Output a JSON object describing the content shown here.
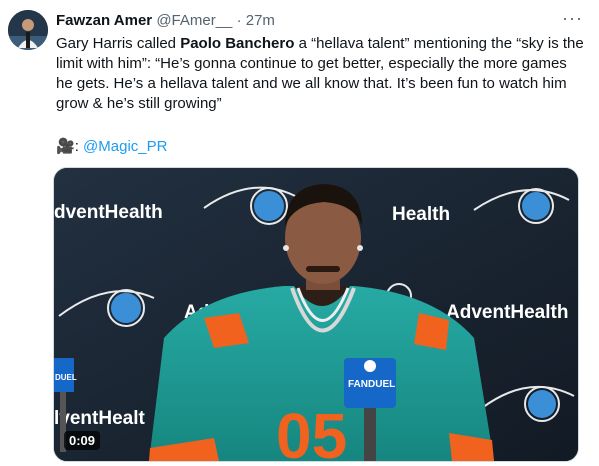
{
  "tweet": {
    "author_name": "Fawzan Amer",
    "handle": "@FAmer__",
    "separator": "·",
    "time": "27m",
    "more_label": "···",
    "text_before": "Gary Harris called ",
    "text_bold": "Paolo Banchero",
    "text_after": " a “hellava talent” mentioning the “sky is the limit with him”: “He’s gonna continue to get better, especially the more games he gets. He’s a hellava talent and we all know that. It’s been fun to watch him grow & he’s still growing”",
    "credit_icon": "🎥",
    "credit_colon": ": ",
    "credit_link": "@Magic_PR"
  },
  "media": {
    "duration": "0:09",
    "backdrop_text": [
      "dventHealth",
      "Health",
      "Adv",
      "AdventHealth",
      "lventHealt"
    ],
    "mic_brand": "FANDUEL",
    "mic_left_text": "DUEL",
    "jersey_number": "05"
  },
  "icons": {
    "avatar": "avatar",
    "more": "more-icon",
    "camera": "video-camera-icon",
    "magic_logo": "orlando-magic-logo-icon"
  },
  "colors": {
    "link": "#1d9bf0",
    "muted": "#536471",
    "text": "#0f1419",
    "backdrop": "#1a2430",
    "jersey_teal": "#1f9f9b",
    "jersey_orange": "#f0621e"
  }
}
